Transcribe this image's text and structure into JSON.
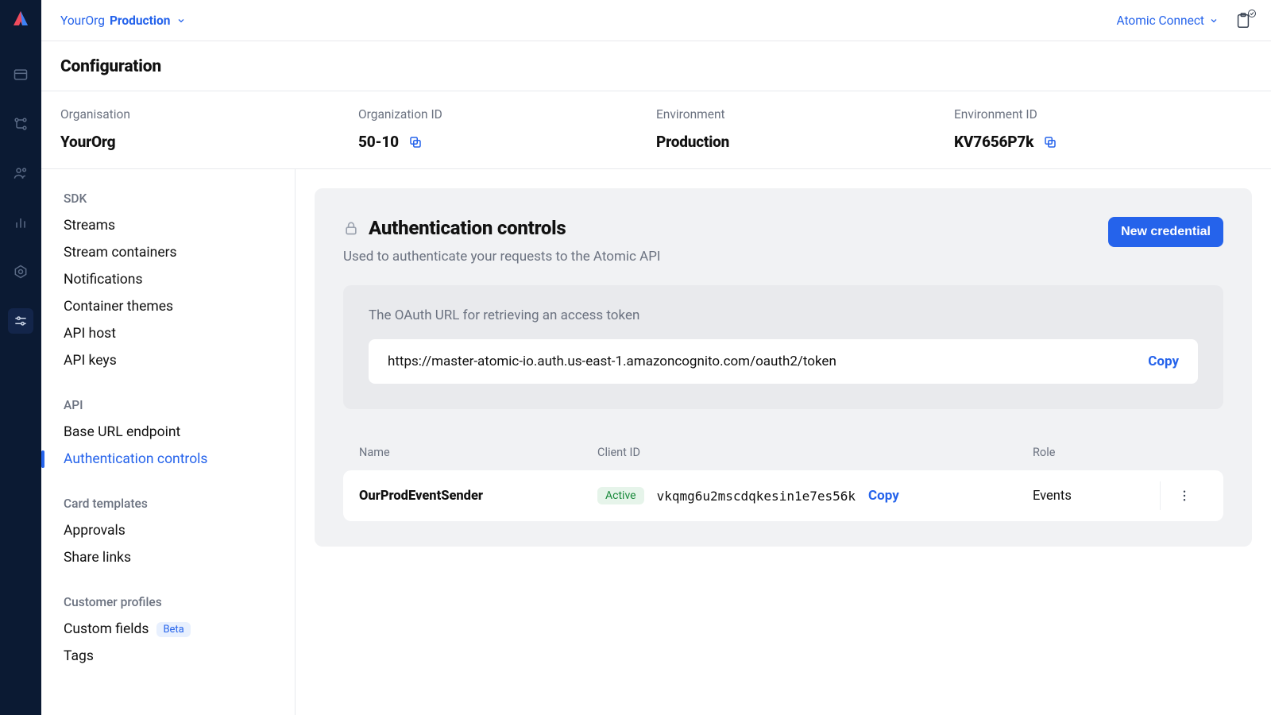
{
  "topbar": {
    "org": "YourOrg",
    "env": "Production",
    "connect_label": "Atomic Connect"
  },
  "page": {
    "title": "Configuration"
  },
  "info": {
    "org_label": "Organisation",
    "org_value": "YourOrg",
    "orgid_label": "Organization ID",
    "orgid_value": "50-10",
    "env_label": "Environment",
    "env_value": "Production",
    "envid_label": "Environment ID",
    "envid_value": "KV7656P7k"
  },
  "sidenav": {
    "groups": [
      {
        "label": "SDK",
        "items": [
          {
            "label": "Streams"
          },
          {
            "label": "Stream containers"
          },
          {
            "label": "Notifications"
          },
          {
            "label": "Container themes"
          },
          {
            "label": "API host"
          },
          {
            "label": "API keys"
          }
        ]
      },
      {
        "label": "API",
        "items": [
          {
            "label": "Base URL endpoint"
          },
          {
            "label": "Authentication controls",
            "active": true
          }
        ]
      },
      {
        "label": "Card templates",
        "items": [
          {
            "label": "Approvals"
          },
          {
            "label": "Share links"
          }
        ]
      },
      {
        "label": "Customer profiles",
        "items": [
          {
            "label": "Custom fields",
            "badge": "Beta"
          },
          {
            "label": "Tags"
          }
        ]
      }
    ]
  },
  "panel": {
    "title": "Authentication controls",
    "subtitle": "Used to authenticate your requests to the Atomic API",
    "new_credential": "New credential",
    "oauth_caption": "The OAuth URL for retrieving an access token",
    "oauth_url": "https://master-atomic-io.auth.us-east-1.amazoncognito.com/oauth2/token",
    "copy_label": "Copy",
    "columns": {
      "name": "Name",
      "clientid": "Client ID",
      "role": "Role"
    },
    "rows": [
      {
        "name": "OurProdEventSender",
        "status": "Active",
        "client_id": "vkqmg6u2mscdqkesin1e7es56k",
        "role": "Events"
      }
    ]
  }
}
